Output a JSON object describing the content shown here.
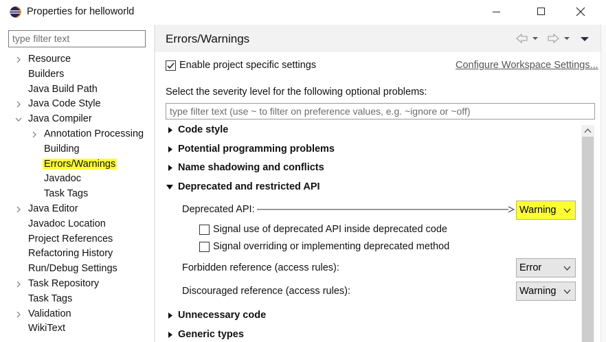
{
  "window": {
    "title": "Properties for helloworld"
  },
  "sidebar": {
    "filter_placeholder": "type filter text",
    "items": [
      {
        "label": "Resource",
        "indent": 1,
        "twisty": "collapsed"
      },
      {
        "label": "Builders",
        "indent": 1,
        "twisty": "none"
      },
      {
        "label": "Java Build Path",
        "indent": 1,
        "twisty": "none"
      },
      {
        "label": "Java Code Style",
        "indent": 1,
        "twisty": "collapsed"
      },
      {
        "label": "Java Compiler",
        "indent": 1,
        "twisty": "expanded"
      },
      {
        "label": "Annotation Processing",
        "indent": 2,
        "twisty": "collapsed"
      },
      {
        "label": "Building",
        "indent": 2,
        "twisty": "none"
      },
      {
        "label": "Errors/Warnings",
        "indent": 2,
        "twisty": "none",
        "selected": true
      },
      {
        "label": "Javadoc",
        "indent": 2,
        "twisty": "none"
      },
      {
        "label": "Task Tags",
        "indent": 2,
        "twisty": "none"
      },
      {
        "label": "Java Editor",
        "indent": 1,
        "twisty": "collapsed"
      },
      {
        "label": "Javadoc Location",
        "indent": 1,
        "twisty": "none"
      },
      {
        "label": "Project References",
        "indent": 1,
        "twisty": "none"
      },
      {
        "label": "Refactoring History",
        "indent": 1,
        "twisty": "none"
      },
      {
        "label": "Run/Debug Settings",
        "indent": 1,
        "twisty": "none"
      },
      {
        "label": "Task Repository",
        "indent": 1,
        "twisty": "collapsed"
      },
      {
        "label": "Task Tags",
        "indent": 1,
        "twisty": "none"
      },
      {
        "label": "Validation",
        "indent": 1,
        "twisty": "collapsed"
      },
      {
        "label": "WikiText",
        "indent": 1,
        "twisty": "none"
      }
    ]
  },
  "main": {
    "title": "Errors/Warnings",
    "enable_project_settings": {
      "label": "Enable project specific settings",
      "checked": true
    },
    "configure_link": "Configure Workspace Settings...",
    "severity_prompt": "Select the severity level for the following optional problems:",
    "options_filter_placeholder": "type filter text (use ~ to filter on preference values, e.g. ~ignore or ~off)",
    "sections": {
      "code_style": "Code style",
      "potential": "Potential programming problems",
      "shadowing": "Name shadowing and conflicts",
      "deprecated": "Deprecated and restricted API",
      "unnecessary": "Unnecessary code",
      "generic": "Generic types"
    },
    "deprecated_api": {
      "label": "Deprecated API:",
      "value": "Warning"
    },
    "signal_inside": {
      "label": "Signal use of deprecated API inside deprecated code",
      "checked": false
    },
    "signal_override": {
      "label": "Signal overriding or implementing deprecated method",
      "checked": false
    },
    "forbidden": {
      "label": "Forbidden reference (access rules):",
      "value": "Error"
    },
    "discouraged": {
      "label": "Discouraged reference (access rules):",
      "value": "Warning"
    }
  },
  "colors": {
    "highlight": "#fdfd33",
    "header_bg": "#f2f2f2",
    "link": "#555555"
  },
  "icons": [
    "eclipse-app-icon",
    "minimize-icon",
    "maximize-icon",
    "close-icon",
    "back-arrow-icon",
    "forward-arrow-icon",
    "view-menu-icon"
  ]
}
